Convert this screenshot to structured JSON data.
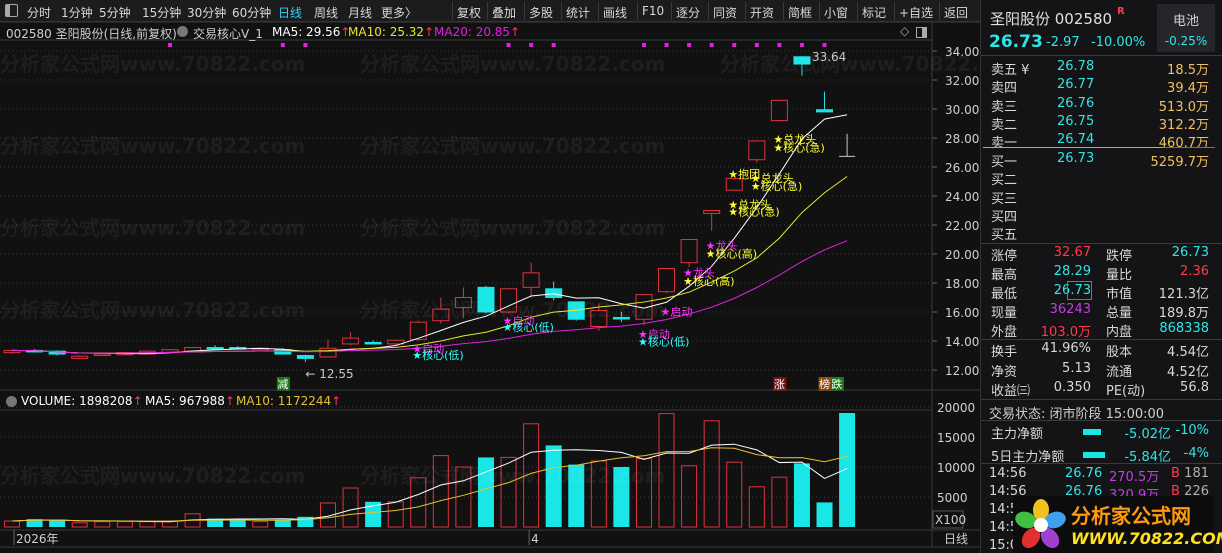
{
  "toolbar": {
    "periods": [
      "分时",
      "1分钟",
      "5分钟",
      "15分钟",
      "30分钟",
      "60分钟",
      "日线",
      "周线",
      "月线",
      "更多〉"
    ],
    "active_period": "日线",
    "buttons": [
      "复权",
      "叠加",
      "多股",
      "统计",
      "画线",
      "F10",
      "逐分",
      "同资",
      "开资",
      "简框",
      "小窗",
      "标记",
      "+自选",
      "返回"
    ]
  },
  "chart_header": {
    "title": "002580 圣阳股份(日线,前复权)",
    "indicator": "交易核心V_1",
    "ma5": "MA5: 29.56",
    "ma10": "MA10: 25.32",
    "ma20": "MA20: 20.85",
    "up_arrow": "↑"
  },
  "volume_header": {
    "volume": "VOLUME: 1898208",
    "ma5": "MA5: 967988",
    "ma10": "MA10: 1172244",
    "up_arrow": "↑"
  },
  "watermark": "分析家公式网www.70822.com",
  "colors": {
    "up": "#e0323e",
    "down": "#19e6e6",
    "ma5": "#ffffff",
    "ma10": "#e6e62e",
    "ma20": "#e020e0",
    "signal_magenta": "#ff30ff",
    "signal_cyan": "#33ffff",
    "signal_yellow": "#ffff33"
  },
  "chart_data": {
    "type": "candlestick",
    "price_axis": {
      "ylim": [
        11,
        35.2
      ],
      "ticks": [
        "34.00",
        "32.00",
        "30.00",
        "28.00",
        "26.00",
        "24.00",
        "22.00",
        "20.00",
        "18.00",
        "16.00",
        "14.00",
        "12.00"
      ]
    },
    "volume_axis": {
      "ylim": [
        0,
        21000
      ],
      "ticks": [
        "20000",
        "15000",
        "10000",
        "5000"
      ],
      "unit": "X100"
    },
    "x_labels": [
      {
        "day": 0,
        "text": "2026年"
      },
      {
        "day": 23,
        "text": "4"
      }
    ],
    "period_label": "日线",
    "ohlc": [
      [
        13.2,
        13.4,
        13.1,
        13.35
      ],
      [
        13.35,
        13.45,
        13.2,
        13.3
      ],
      [
        13.3,
        13.35,
        13.0,
        13.1
      ],
      [
        12.8,
        13.0,
        12.75,
        12.95
      ],
      [
        13.0,
        13.15,
        12.95,
        13.1
      ],
      [
        13.05,
        13.25,
        13.0,
        13.2
      ],
      [
        13.1,
        13.35,
        13.05,
        13.3
      ],
      [
        13.2,
        13.45,
        13.15,
        13.4
      ],
      [
        13.3,
        13.6,
        13.25,
        13.55
      ],
      [
        13.55,
        13.7,
        13.45,
        13.5
      ],
      [
        13.55,
        13.65,
        13.4,
        13.5
      ],
      [
        13.4,
        13.55,
        13.35,
        13.5
      ],
      [
        13.4,
        13.5,
        13.05,
        13.1
      ],
      [
        13.0,
        13.05,
        12.55,
        12.8
      ],
      [
        12.9,
        14.1,
        12.85,
        13.5
      ],
      [
        13.8,
        14.6,
        13.7,
        14.2
      ],
      [
        13.9,
        14.05,
        13.75,
        13.88
      ],
      [
        13.8,
        14.1,
        13.7,
        14.05
      ],
      [
        14.1,
        15.4,
        14.0,
        15.3
      ],
      [
        15.4,
        17.0,
        15.2,
        16.2
      ],
      [
        16.3,
        17.7,
        15.6,
        17.0
      ],
      [
        17.7,
        17.8,
        15.9,
        16.0
      ],
      [
        16.0,
        17.6,
        15.9,
        17.6
      ],
      [
        17.7,
        19.4,
        17.0,
        18.7
      ],
      [
        17.6,
        18.1,
        16.8,
        17.0
      ],
      [
        16.7,
        16.7,
        15.4,
        15.5
      ],
      [
        15.0,
        16.6,
        14.7,
        16.1
      ],
      [
        15.62,
        16.0,
        15.3,
        15.55
      ],
      [
        15.5,
        17.2,
        15.1,
        17.2
      ],
      [
        17.4,
        19.0,
        17.3,
        19.0
      ],
      [
        19.4,
        21.0,
        19.1,
        21.0
      ],
      [
        22.8,
        23.0,
        21.6,
        23.0
      ],
      [
        24.4,
        25.2,
        24.4,
        25.2
      ],
      [
        26.5,
        27.8,
        26.3,
        27.8
      ],
      [
        29.2,
        30.6,
        29.2,
        30.6
      ],
      [
        33.6,
        33.64,
        32.3,
        33.1
      ],
      [
        29.95,
        31.2,
        29.8,
        29.8
      ],
      [
        26.73,
        28.29,
        26.73,
        26.73
      ]
    ],
    "volume": [
      1000,
      1300,
      1200,
      700,
      900,
      900,
      900,
      1000,
      2200,
      1400,
      1200,
      900,
      1200,
      1700,
      4000,
      6500,
      4200,
      4200,
      8200,
      11900,
      10000,
      11600,
      11600,
      17200,
      13600,
      10400,
      11000,
      10000,
      11400,
      18900,
      10200,
      17700,
      10800,
      6700,
      8300,
      10600,
      4100,
      19000
    ],
    "volume_down_days": [
      1,
      2,
      9,
      10,
      12,
      13,
      16,
      21,
      24,
      25,
      27,
      35,
      36,
      37
    ],
    "flat_days": [
      37
    ],
    "annotations": [
      {
        "day": 13,
        "price": 12.55,
        "text": "← 12.55"
      },
      {
        "day": 35,
        "price": 33.64,
        "text": "33.64"
      }
    ],
    "top_dots_days": [
      7,
      12,
      13,
      22,
      23,
      24,
      28,
      29,
      30,
      31,
      32,
      33,
      34,
      35,
      36
    ],
    "signals": [
      {
        "day": 18,
        "price": 13.55,
        "text": "★启动",
        "color": "magenta"
      },
      {
        "day": 18,
        "price": 13.1,
        "text": "★核心(低)",
        "color": "cyan"
      },
      {
        "day": 22,
        "price": 15.5,
        "text": "★启动",
        "color": "magenta"
      },
      {
        "day": 22,
        "price": 15.05,
        "text": "★核心(低)",
        "color": "cyan"
      },
      {
        "day": 28,
        "price": 14.55,
        "text": "★启动",
        "color": "magenta"
      },
      {
        "day": 28,
        "price": 14.05,
        "text": "★核心(低)",
        "color": "cyan"
      },
      {
        "day": 29,
        "price": 16.1,
        "text": "★启动",
        "color": "magenta"
      },
      {
        "day": 30,
        "price": 18.8,
        "text": "★龙头",
        "color": "magenta"
      },
      {
        "day": 30,
        "price": 18.2,
        "text": "★核心(高)",
        "color": "yellow"
      },
      {
        "day": 31,
        "price": 20.65,
        "text": "★龙头",
        "color": "magenta"
      },
      {
        "day": 31,
        "price": 20.1,
        "text": "★核心(高)",
        "color": "yellow"
      },
      {
        "day": 32,
        "price": 23.5,
        "text": "★总龙头",
        "color": "yellow"
      },
      {
        "day": 32,
        "price": 23.0,
        "text": "★核心(急)",
        "color": "yellow"
      },
      {
        "day": 32,
        "price": 25.6,
        "text": "★抱团",
        "color": "yellow"
      },
      {
        "day": 33,
        "price": 25.3,
        "text": "★总龙头",
        "color": "yellow"
      },
      {
        "day": 33,
        "price": 24.75,
        "text": "★核心(急)",
        "color": "yellow"
      },
      {
        "day": 34,
        "price": 28.0,
        "text": "★总龙头",
        "color": "yellow"
      },
      {
        "day": 34,
        "price": 27.4,
        "text": "★核心(急)",
        "color": "yellow"
      }
    ],
    "event_tags": [
      {
        "day": 12,
        "text": "减",
        "bg": "#1a7a1a"
      },
      {
        "day": 34,
        "text": "涨",
        "bg": "#7a1010"
      },
      {
        "day": 36,
        "text": "榜",
        "bg": "#8a4a10"
      },
      {
        "day": 36.55,
        "text": "跌",
        "bg": "#1a7a1a"
      }
    ]
  },
  "quote": {
    "name": "圣阳股份 002580",
    "badge": "R",
    "sector": "电池",
    "sector_change": "-0.25%",
    "price": "26.73",
    "change": "-2.97",
    "change_pct": "-10.00%",
    "sell": [
      {
        "label": "卖五 ¥",
        "price": "26.78",
        "vol": "18.5万"
      },
      {
        "label": "卖四",
        "price": "26.77",
        "vol": "39.4万"
      },
      {
        "label": "卖三",
        "price": "26.76",
        "vol": "513.0万"
      },
      {
        "label": "卖二",
        "price": "26.75",
        "vol": "312.2万"
      },
      {
        "label": "卖一",
        "price": "26.74",
        "vol": "460.7万"
      }
    ],
    "buy": [
      {
        "label": "买一",
        "price": "26.73",
        "vol": "5259.7万"
      },
      {
        "label": "买二",
        "price": "",
        "vol": ""
      },
      {
        "label": "买三",
        "price": "",
        "vol": ""
      },
      {
        "label": "买四",
        "price": "",
        "vol": ""
      },
      {
        "label": "买五",
        "price": "",
        "vol": ""
      }
    ],
    "stats": [
      {
        "l1": "涨停",
        "v1": "32.67",
        "c1": "rd",
        "l2": "跌停",
        "v2": "26.73",
        "c2": "cy"
      },
      {
        "l1": "最高",
        "v1": "28.29",
        "c1": "cy",
        "l2": "量比",
        "v2": "2.36",
        "c2": "rd"
      },
      {
        "l1": "最低",
        "v1": "26.73",
        "c1": "cy",
        "l2": "市值",
        "v2": "121.3亿",
        "c2": "wh"
      },
      {
        "l1": "现量",
        "v1": "36243",
        "c1": "mg",
        "l2": "总量",
        "v2": "189.8万",
        "c2": "wh"
      },
      {
        "l1": "外盘",
        "v1": "103.0万",
        "c1": "rd",
        "l2": "内盘",
        "v2": "868338",
        "c2": "cy"
      }
    ],
    "stats2": [
      {
        "l1": "换手",
        "v1": "41.96%",
        "l2": "股本",
        "v2": "4.54亿"
      },
      {
        "l1": "净资",
        "v1": "5.13",
        "l2": "流通",
        "v2": "4.52亿"
      },
      {
        "l1": "收益㈢",
        "v1": "0.350",
        "l2": "PE(动)",
        "v2": "56.8"
      }
    ],
    "trade_status": "交易状态: 闭市阶段 15:00:00",
    "fund_flow": [
      {
        "label": "主力净额",
        "value": "-5.02亿",
        "pct": "-10%"
      },
      {
        "label": "5日主力净额",
        "value": "-5.84亿",
        "pct": "-4%"
      }
    ],
    "ticks": [
      {
        "time": "14:56",
        "price": "26.76",
        "amount": "270.5万",
        "side": "B",
        "count": "181"
      },
      {
        "time": "14:56",
        "price": "26.76",
        "amount": "320.9万",
        "side": "B",
        "count": "226"
      },
      {
        "time": "14:5",
        "price": "",
        "amount": "",
        "side": "",
        "count": ""
      },
      {
        "time": "14:5",
        "price": "",
        "amount": "",
        "side": "",
        "count": ""
      },
      {
        "time": "15:0",
        "price": "",
        "amount": "",
        "side": "",
        "count": ""
      }
    ],
    "logo_title": "分析家公式网",
    "logo_url": "WWW.70822.COM"
  }
}
